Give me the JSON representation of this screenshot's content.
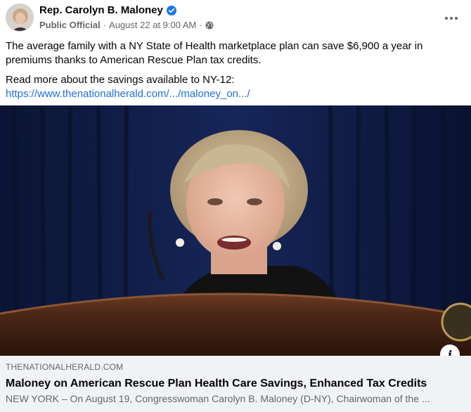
{
  "post": {
    "author": "Rep. Carolyn B. Maloney",
    "role": "Public Official",
    "separator": "·",
    "timestamp": "August 22 at 9:00 AM",
    "separator2": "·",
    "text_line1": "The average family with a NY State of Health marketplace plan can save $6,900 a year in premiums thanks to American Rescue Plan tax credits.",
    "text_line2": "Read more about the savings available to NY-12:",
    "link_text": "https://www.thenationalherald.com/.../maloney_on.../"
  },
  "link_preview": {
    "domain": "THENATIONALHERALD.COM",
    "title": "Maloney on American Rescue Plan Health Care Savings, Enhanced Tax Credits",
    "description": "NEW YORK – On August 19, Congresswoman Carolyn B. Maloney (D-NY), Chairwoman of the ...",
    "info_label": "i"
  },
  "colors": {
    "link": "#216fdb",
    "verified": "#1877f2",
    "meta_text": "#65676b",
    "card_bg": "#f0f2f5"
  },
  "icons": {
    "verified": "verified-badge-icon",
    "globe": "globe-icon",
    "more": "more-horizontal-icon",
    "info": "info-icon"
  }
}
